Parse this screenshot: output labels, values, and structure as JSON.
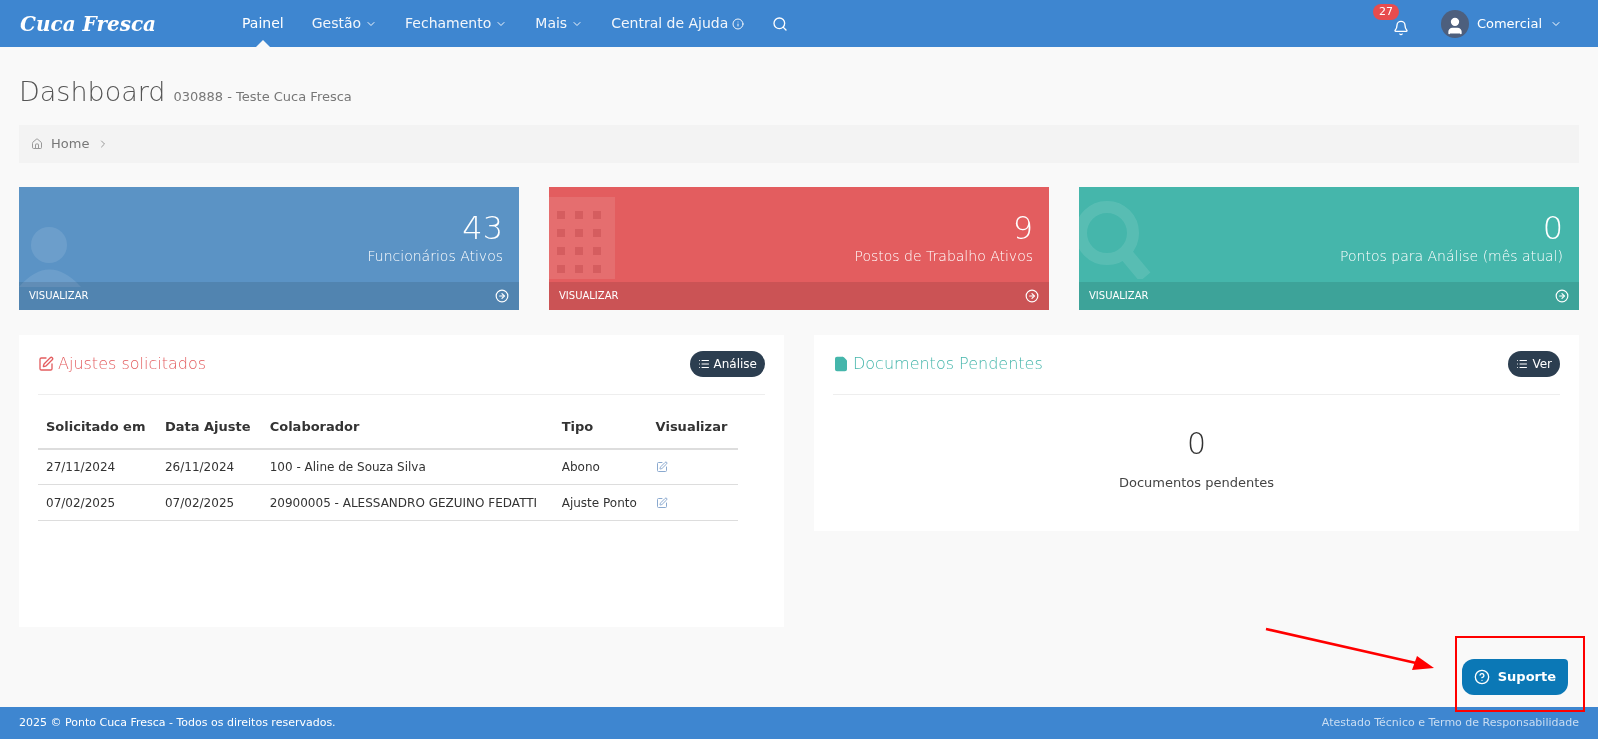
{
  "navbar": {
    "brand": "Cuca Fresca",
    "menu": [
      {
        "label": "Painel",
        "kind": "link",
        "selected": true
      },
      {
        "label": "Gestão",
        "kind": "dropdown",
        "selected": false
      },
      {
        "label": "Fechamento",
        "kind": "dropdown",
        "selected": false
      },
      {
        "label": "Mais",
        "kind": "dropdown",
        "selected": false
      },
      {
        "label": "Central de Ajuda",
        "kind": "info",
        "selected": false
      }
    ],
    "notifications": "27",
    "user": "Comercial"
  },
  "page": {
    "title": "Dashboard",
    "subtitle": "030888 - Teste Cuca Fresca"
  },
  "breadcrumb": [
    "Home"
  ],
  "stats": [
    {
      "value": "43",
      "label": "Funcionários Ativos",
      "link": "VISUALIZAR",
      "color": "#5b93c5",
      "kind": "user"
    },
    {
      "value": "9",
      "label": "Postos de Trabalho Ativos",
      "link": "VISUALIZAR",
      "color": "#e35d5f",
      "kind": "building"
    },
    {
      "value": "0",
      "label": "Pontos para Análise (mês atual)",
      "link": "VISUALIZAR",
      "color": "#45b6ab",
      "kind": "search"
    }
  ],
  "adjustments": {
    "title": "Ajustes solicitados",
    "button": "Análise",
    "columns": [
      "Solicitado em",
      "Data Ajuste",
      "Colaborador",
      "Tipo",
      "Visualizar"
    ],
    "rows": [
      [
        "27/11/2024",
        "26/11/2024",
        "100 - Aline de Souza Silva",
        "Abono"
      ],
      [
        "07/02/2025",
        "07/02/2025",
        "20900005 - ALESSANDRO GEZUINO FEDATTI",
        "Ajuste Ponto"
      ]
    ]
  },
  "documents": {
    "title": "Documentos Pendentes",
    "button": "Ver",
    "count": "0",
    "caption": "Documentos pendentes"
  },
  "support_button": "Suporte",
  "footer": {
    "copyright": "2025 © Ponto Cuca Fresca - Todos os direitos reservados.",
    "link": "Atestado Técnico e Termo de Responsabilidade"
  }
}
